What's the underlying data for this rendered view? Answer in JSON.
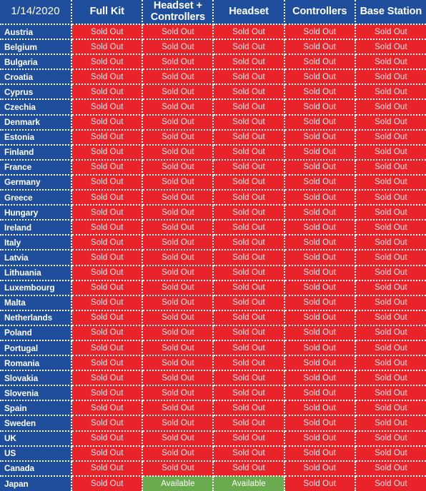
{
  "table": {
    "title_cell": "1/14/2020",
    "columns": [
      {
        "key": "full_kit",
        "label": "Full Kit"
      },
      {
        "key": "headset_controllers",
        "label": "Headset +\nControllers"
      },
      {
        "key": "headset",
        "label": "Headset"
      },
      {
        "key": "controllers",
        "label": "Controllers"
      },
      {
        "key": "base_station",
        "label": "Base Station"
      }
    ],
    "status_labels": {
      "sold_out": "Sold Out",
      "available": "Available"
    },
    "colors": {
      "header_blue": "#1f4e9c",
      "country_blue": "#1f4e9c",
      "sold_out_red": "#e8232a",
      "available_green": "#6aab4f",
      "gridline_white": "#ffffff",
      "header_text": "#ffffff",
      "status_text": "#f5e9ea"
    },
    "rows": [
      {
        "country": "Austria",
        "cells": [
          "Sold Out",
          "Sold Out",
          "Sold Out",
          "Sold Out",
          "Sold Out"
        ]
      },
      {
        "country": "Belgium",
        "cells": [
          "Sold Out",
          "Sold Out",
          "Sold Out",
          "Sold Out",
          "Sold Out"
        ]
      },
      {
        "country": "Bulgaria",
        "cells": [
          "Sold Out",
          "Sold Out",
          "Sold Out",
          "Sold Out",
          "Sold Out"
        ]
      },
      {
        "country": "Croatia",
        "cells": [
          "Sold Out",
          "Sold Out",
          "Sold Out",
          "Sold Out",
          "Sold Out"
        ]
      },
      {
        "country": "Cyprus",
        "cells": [
          "Sold Out",
          "Sold Out",
          "Sold Out",
          "Sold Out",
          "Sold Out"
        ]
      },
      {
        "country": "Czechia",
        "cells": [
          "Sold Out",
          "Sold Out",
          "Sold Out",
          "Sold Out",
          "Sold Out"
        ]
      },
      {
        "country": "Denmark",
        "cells": [
          "Sold Out",
          "Sold Out",
          "Sold Out",
          "Sold Out",
          "Sold Out"
        ]
      },
      {
        "country": "Estonia",
        "cells": [
          "Sold Out",
          "Sold Out",
          "Sold Out",
          "Sold Out",
          "Sold Out"
        ]
      },
      {
        "country": "Finland",
        "cells": [
          "Sold Out",
          "Sold Out",
          "Sold Out",
          "Sold Out",
          "Sold Out"
        ]
      },
      {
        "country": "France",
        "cells": [
          "Sold Out",
          "Sold Out",
          "Sold Out",
          "Sold Out",
          "Sold Out"
        ]
      },
      {
        "country": "Germany",
        "cells": [
          "Sold Out",
          "Sold Out",
          "Sold Out",
          "Sold Out",
          "Sold Out"
        ]
      },
      {
        "country": "Greece",
        "cells": [
          "Sold Out",
          "Sold Out",
          "Sold Out",
          "Sold Out",
          "Sold Out"
        ]
      },
      {
        "country": "Hungary",
        "cells": [
          "Sold Out",
          "Sold Out",
          "Sold Out",
          "Sold Out",
          "Sold Out"
        ]
      },
      {
        "country": "Ireland",
        "cells": [
          "Sold Out",
          "Sold Out",
          "Sold Out",
          "Sold Out",
          "Sold Out"
        ]
      },
      {
        "country": "Italy",
        "cells": [
          "Sold Out",
          "Sold Out",
          "Sold Out",
          "Sold Out",
          "Sold Out"
        ]
      },
      {
        "country": "Latvia",
        "cells": [
          "Sold Out",
          "Sold Out",
          "Sold Out",
          "Sold Out",
          "Sold Out"
        ]
      },
      {
        "country": "Lithuania",
        "cells": [
          "Sold Out",
          "Sold Out",
          "Sold Out",
          "Sold Out",
          "Sold Out"
        ]
      },
      {
        "country": "Luxembourg",
        "cells": [
          "Sold Out",
          "Sold Out",
          "Sold Out",
          "Sold Out",
          "Sold Out"
        ]
      },
      {
        "country": "Malta",
        "cells": [
          "Sold Out",
          "Sold Out",
          "Sold Out",
          "Sold Out",
          "Sold Out"
        ]
      },
      {
        "country": "Netherlands",
        "cells": [
          "Sold Out",
          "Sold Out",
          "Sold Out",
          "Sold Out",
          "Sold Out"
        ]
      },
      {
        "country": "Poland",
        "cells": [
          "Sold Out",
          "Sold Out",
          "Sold Out",
          "Sold Out",
          "Sold Out"
        ]
      },
      {
        "country": "Portugal",
        "cells": [
          "Sold Out",
          "Sold Out",
          "Sold Out",
          "Sold Out",
          "Sold Out"
        ]
      },
      {
        "country": "Romania",
        "cells": [
          "Sold Out",
          "Sold Out",
          "Sold Out",
          "Sold Out",
          "Sold Out"
        ]
      },
      {
        "country": "Slovakia",
        "cells": [
          "Sold Out",
          "Sold Out",
          "Sold Out",
          "Sold Out",
          "Sold Out"
        ]
      },
      {
        "country": "Slovenia",
        "cells": [
          "Sold Out",
          "Sold Out",
          "Sold Out",
          "Sold Out",
          "Sold Out"
        ]
      },
      {
        "country": "Spain",
        "cells": [
          "Sold Out",
          "Sold Out",
          "Sold Out",
          "Sold Out",
          "Sold Out"
        ]
      },
      {
        "country": "Sweden",
        "cells": [
          "Sold Out",
          "Sold Out",
          "Sold Out",
          "Sold Out",
          "Sold Out"
        ]
      },
      {
        "country": "UK",
        "cells": [
          "Sold Out",
          "Sold Out",
          "Sold Out",
          "Sold Out",
          "Sold Out"
        ]
      },
      {
        "country": "US",
        "cells": [
          "Sold Out",
          "Sold Out",
          "Sold Out",
          "Sold Out",
          "Sold Out"
        ]
      },
      {
        "country": "Canada",
        "cells": [
          "Sold Out",
          "Sold Out",
          "Sold Out",
          "Sold Out",
          "Sold Out"
        ]
      },
      {
        "country": "Japan",
        "cells": [
          "Sold Out",
          "Available",
          "Available",
          "Sold Out",
          "Sold Out"
        ]
      }
    ]
  }
}
